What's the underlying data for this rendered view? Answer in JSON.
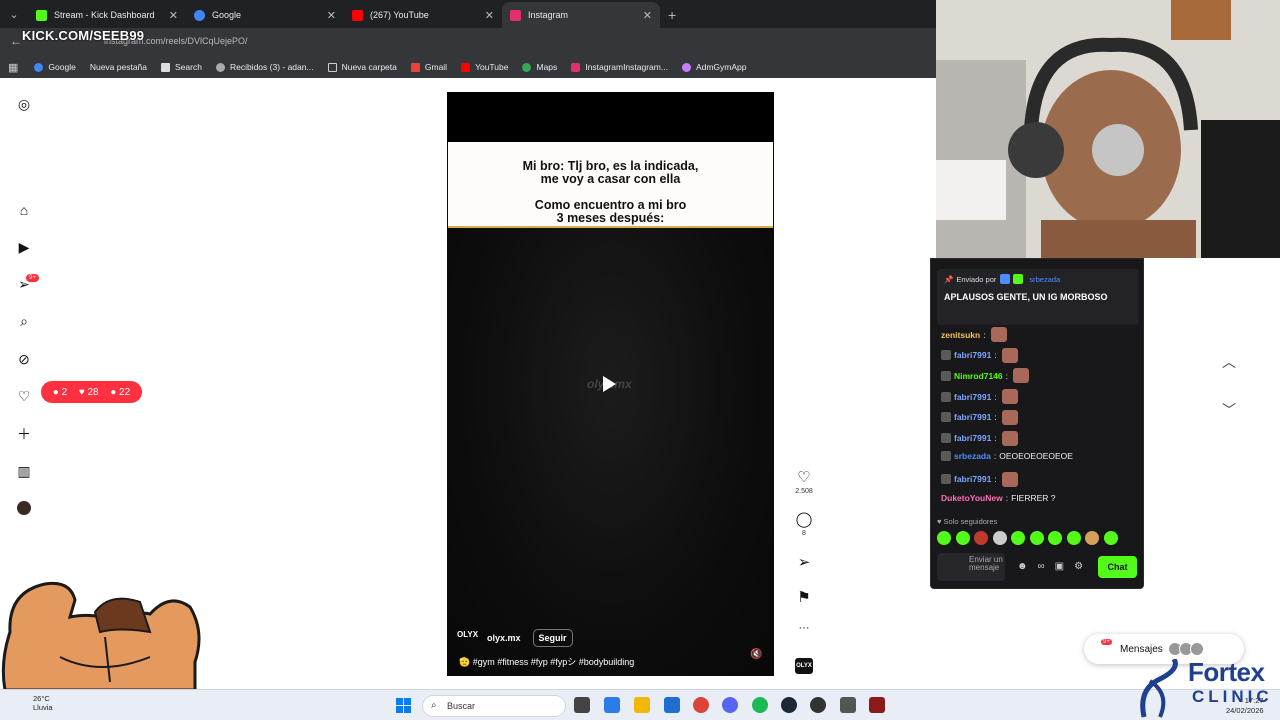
{
  "browser": {
    "tabs": [
      {
        "title": "Stream - Kick Dashboard",
        "color": "#53fc18"
      },
      {
        "title": "Google",
        "color": "#4285f4"
      },
      {
        "title": "(267) YouTube",
        "color": "#ff0000"
      },
      {
        "title": "Instagram",
        "color": "#e1306c"
      }
    ],
    "url": "instagram.com/reels/DVlCqUejePO/",
    "bookmarks": [
      "Google",
      "Nueva pestaña",
      "Search",
      "Recibidos (3) - adan...",
      "Nueva carpeta",
      "Gmail",
      "YouTube",
      "Maps",
      "InstagramInstagram...",
      "AdmGymApp"
    ]
  },
  "overlay": {
    "kick_handle": "KICK.COM/SEEB99"
  },
  "instagram": {
    "nav_badge": "9+",
    "notifications": {
      "comments": "2",
      "likes": "28",
      "followers": "22"
    },
    "reel": {
      "caption_line1": "Mi bro: Tlj bro, es la indicada,",
      "caption_line2": "me voy a casar con ella",
      "caption_line3": "Como encuentro a mi bro",
      "caption_line4": "3 meses después:",
      "watermark": "olyx.mx",
      "author_logo": "OLYX",
      "author": "olyx.mx",
      "follow_label": "Seguir",
      "hashtags": "🫡 #gym #fitness #fyp #fypシ #bodybuilding"
    },
    "actions": {
      "likes": "2.508",
      "comments": "8"
    },
    "messages": {
      "label": "Mensajes",
      "badge": "9+"
    }
  },
  "chat": {
    "pinned_by_prefix": "Enviado por",
    "pinned_user": "srbezada",
    "pinned_message": "APLAUSOS GENTE, UN IG MORBOSO",
    "lines": [
      {
        "user": "zenitsukn",
        "text": "",
        "color": "#f3c35a",
        "emote": true
      },
      {
        "user": "fabri7991",
        "text": "",
        "color": "#7da6ff",
        "emote": true
      },
      {
        "user": "Nimrod7146",
        "text": "",
        "color": "#53fc18",
        "emote": true
      },
      {
        "user": "fabri7991",
        "text": "",
        "color": "#7da6ff",
        "emote": true
      },
      {
        "user": "fabri7991",
        "text": "",
        "color": "#7da6ff",
        "emote": true
      },
      {
        "user": "fabri7991",
        "text": "",
        "color": "#7da6ff",
        "emote": true
      },
      {
        "user": "srbezada",
        "text": "OEOEOEOEOEOE",
        "color": "#4c8dff",
        "emote": false
      },
      {
        "user": "fabri7991",
        "text": "",
        "color": "#7da6ff",
        "emote": true
      },
      {
        "user": "DuketoYouNew",
        "text": "FIERRER ?",
        "color": "#ff6fb5",
        "emote": false
      }
    ],
    "followers_only": "Solo seguidores",
    "input_placeholder": "Enviar un mensaje",
    "send_label": "Chat"
  },
  "taskbar": {
    "weather_temp": "26°C",
    "weather_desc": "Lluvia",
    "search_placeholder": "Buscar",
    "time": "17:27",
    "date": "24/02/2026"
  },
  "sponsor": {
    "line1": "Fortex",
    "line2": "CLINIC"
  }
}
